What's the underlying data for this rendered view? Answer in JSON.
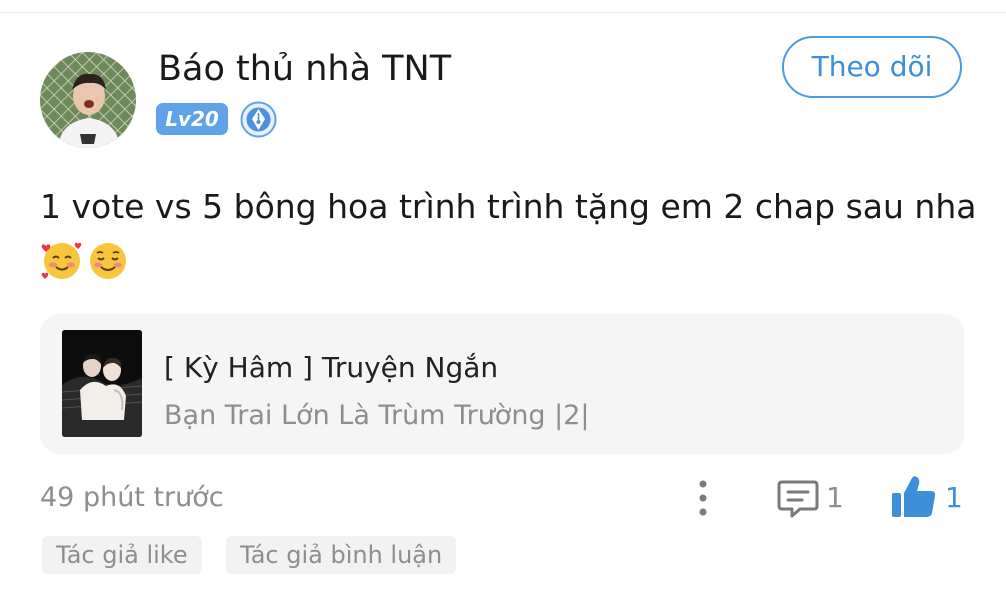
{
  "author": {
    "name": "Báo thủ nhà TNT",
    "level": "Lv20",
    "avatar_icon": "avatar-photo",
    "badge_icon": "pen-nib-icon"
  },
  "follow_button": {
    "label": "Theo dõi"
  },
  "post": {
    "text": "1 vote vs 5 bông hoa trình trình tặng em 2 chap sau nha",
    "emojis": [
      "smiling-face-with-hearts",
      "smiling-face"
    ]
  },
  "story": {
    "title": "[ Kỳ Hâm ] Truyện Ngắn",
    "chapter": "Bạn Trai Lớn Là Trùm Trường |2|"
  },
  "footer": {
    "timestamp": "49 phút trước",
    "comment_count": "1",
    "like_count": "1"
  },
  "tags": [
    "Tác giả like",
    "Tác giả bình luận"
  ],
  "colors": {
    "accent": "#4a9be0",
    "like_blue": "#3d8fd7",
    "muted_text": "#8e8e8e",
    "card_bg": "#f5f5f5"
  }
}
